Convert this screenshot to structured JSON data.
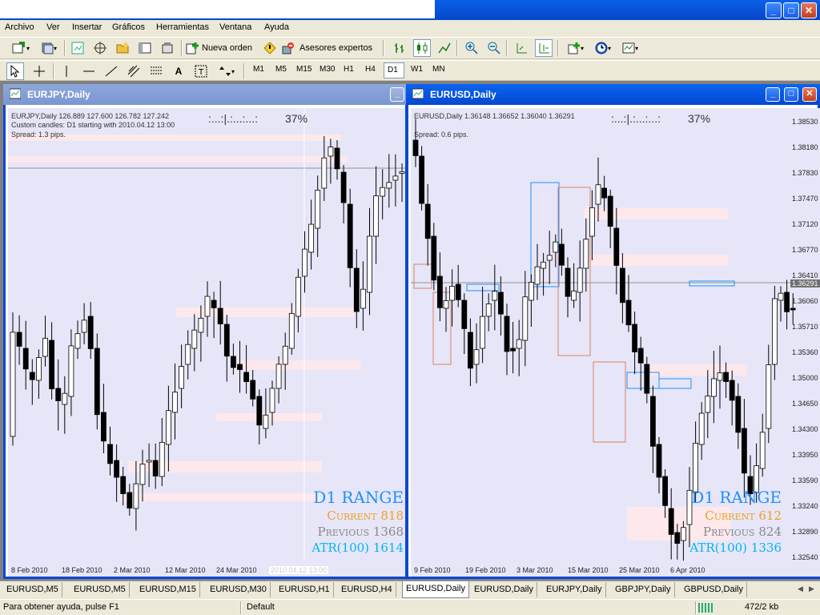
{
  "menu": [
    "Archivo",
    "Ver",
    "Insertar",
    "Gráficos",
    "Herramientas",
    "Ventana",
    "Ayuda"
  ],
  "toolbar": {
    "new_order": "Nueva orden",
    "experts": "Asesores expertos",
    "timeframes": [
      "M1",
      "M5",
      "M15",
      "M30",
      "H1",
      "H4",
      "D1",
      "W1",
      "MN"
    ],
    "active_timeframe": "D1"
  },
  "left_chart": {
    "window_title": "EURJPY,Daily",
    "info": "EURJPY,Daily  126.889 127.600 126.782 127.242",
    "custom": "Custom candles: D1 starting with 2010.04.12 13:00",
    "spread": "Spread: 1.3 pips.",
    "timer": ":...:|.:...:...:",
    "percent": "37%",
    "dates": [
      "8 Feb 2010",
      "18 Feb 2010",
      "2 Mar 2010",
      "12 Mar 2010",
      "24 Mar 2010",
      "2010.04.12 13:00"
    ],
    "range": {
      "title": "D1 RANGE",
      "current_label": "Current",
      "current": "818",
      "previous_label": "Previous",
      "previous": "1368",
      "atr_label": "ATR(100)",
      "atr": "1614"
    }
  },
  "right_chart": {
    "window_title": "EURUSD,Daily",
    "info": "EURUSD,Daily  1.36148 1.36652 1.36040 1.36291",
    "spread": "Spread: 0.6 pips.",
    "timer": ":...:|.:...:...:",
    "percent": "37%",
    "dates": [
      "9 Feb 2010",
      "19 Feb 2010",
      "3 Mar 2010",
      "15 Mar 2010",
      "25 Mar 2010",
      "6 Apr 2010"
    ],
    "prices": [
      "1.38530",
      "1.38180",
      "1.37830",
      "1.37470",
      "1.37120",
      "1.36770",
      "1.36410",
      "1.36060",
      "1.35710",
      "1.35360",
      "1.35000",
      "1.34650",
      "1.34300",
      "1.33950",
      "1.33590",
      "1.33240",
      "1.32890",
      "1.32540"
    ],
    "current_price": "1.36291",
    "range": {
      "title": "D1 RANGE",
      "current_label": "Current",
      "current": "612",
      "previous_label": "Previous",
      "previous": "824",
      "atr_label": "ATR(100)",
      "atr": "1336"
    }
  },
  "tabs": [
    "EURUSD,M5",
    "EURUSD,M5",
    "EURUSD,M15",
    "EURUSD,M30",
    "EURUSD,H1",
    "EURUSD,H4",
    "EURUSD,Daily",
    "EURUSD,Daily",
    "EURJPY,Daily",
    "GBPJPY,Daily",
    "GBPUSD,Daily"
  ],
  "active_tab": 6,
  "status": {
    "help": "Para obtener ayuda, pulse F1",
    "profile": "Default",
    "traffic": "472/2 kb"
  },
  "colors": {
    "bull": "#ffffff",
    "bear": "#000000",
    "chart_bg": "#e6e6f8",
    "active_title": "#0448d0",
    "range_title": "#1e90ff",
    "current": "#f0a020",
    "previous": "#888888",
    "atr": "#00b4f0"
  }
}
